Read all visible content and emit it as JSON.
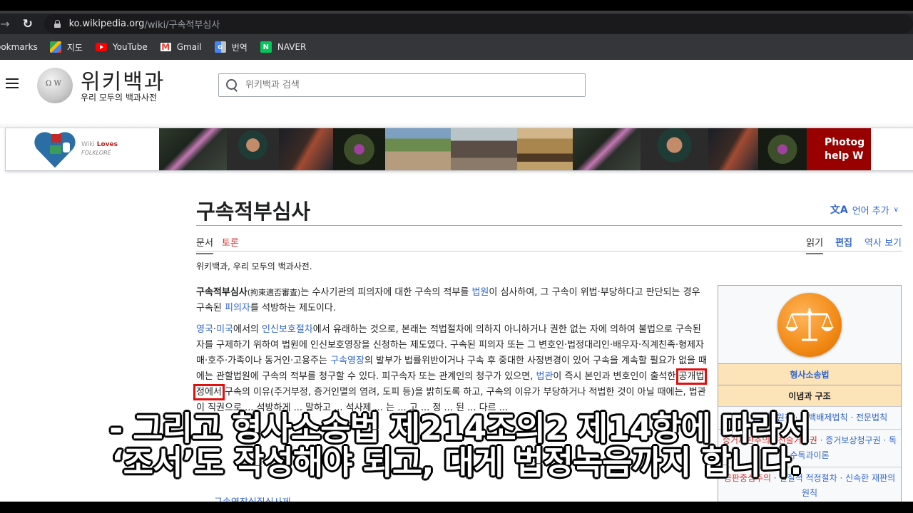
{
  "browser": {
    "url_host": "ko.wikipedia.org",
    "url_path": "/wiki/구속적부심사",
    "bookmarks": [
      {
        "label": "ookmarks",
        "icon": "none"
      },
      {
        "label": "지도",
        "icon": "maps-icon"
      },
      {
        "label": "YouTube",
        "icon": "youtube-icon"
      },
      {
        "label": "Gmail",
        "icon": "gmail-icon"
      },
      {
        "label": "번역",
        "icon": "translate-icon"
      },
      {
        "label": "NAVER",
        "icon": "naver-icon"
      }
    ]
  },
  "site": {
    "title": "위키백과",
    "tagline": "우리 모두의 백과사전",
    "search_placeholder": "위키백과 검색"
  },
  "banner": {
    "logo_wiki": "Wiki",
    "logo_loves": "Loves",
    "logo_folklore": "FOLKLORE",
    "cta_line1": "Photog",
    "cta_line2": "help W"
  },
  "article": {
    "title": "구속적부심사",
    "add_language": "언어 추가",
    "tabs_left": [
      "문서",
      "토론"
    ],
    "tabs_right": [
      "읽기",
      "편집",
      "역사 보기"
    ],
    "from": "위키백과, 우리 모두의 백과사전.",
    "p1": {
      "bold": "구속적부심사",
      "hanja": "(拘束適否審査)",
      "t1": "는 수사기관의 피의자에 대한 구속의 적부를 ",
      "link1": "법원",
      "t2": "이 심사하여, 그 구속이 위법·부당하다고 판단되는 경우 구속된 ",
      "link2": "피의자",
      "t3": "를 석방하는 제도이다."
    },
    "p2": {
      "link1": "영국",
      "sep": "·",
      "link2": "미국",
      "t1": "에서의 ",
      "link3": "인신보호절차",
      "t2": "에서 유래하는 것으로, 본래는 적법절차에 의하지 아니하거나 권한 없는 자에 의하여 불법으로 구속된 자를 구제하기 위하여 법원에 인신보호영장을 신청하는 제도였다. 구속된 피의자 또는 그 변호인·법정대리인·배우자·직계친족·형제자매·호주·가족이나 동거인·고용주는 ",
      "link4": "구속영장",
      "t3": "의 발부가 법률위반이거나 구속 후 중대한 사정변경이 있어 구속을 계속할 필요가 없을 때에는 관할법원에 구속의 적부를 청구할 수 있다. 피구속자 또는 관계인의 청구가 있으면, ",
      "link5": "법관",
      "t4": "이 즉시 본인과 변호인이 출석한 ",
      "highlight": "공개법정에서",
      "t5": " 구속의 이유(주거부정, 증거인멸의 염려, 도피 등)을 밝히도록 하고, 구속의 이유가 부당하거나 적법한 것이 아닐 때에는, 법관이 직권으로 ... 석방하게 ... 말하고 ... 석사제 ... 는 ... 고 ... 정 ... 된 ... 다르 ..."
    },
    "next_section_link": "구속영장실질심사제"
  },
  "infobox": {
    "title": "형사소송법",
    "section": "이념과 구조",
    "rows": [
      {
        "items": [
          "무죄 추정의 원칙",
          "자백배제법칙",
          "전문법칙"
        ],
        "color": "link"
      },
      {
        "items": [
          "증거재판주의",
          "진술거부권",
          "증거보상청구권",
          "독수독과이론"
        ],
        "color": "mixed"
      },
      {
        "items": [
          "공판중심주의",
          "실질적 적정절차",
          "신속한 재판의 원칙"
        ],
        "color": "mixed"
      }
    ]
  },
  "subtitle": {
    "line1": "-  그리고 형사소송법 제214조의2 제14항에 따라서",
    "line2": "‘조서’도 작성해야 되고, 대게 법정녹음까지 합니다."
  }
}
